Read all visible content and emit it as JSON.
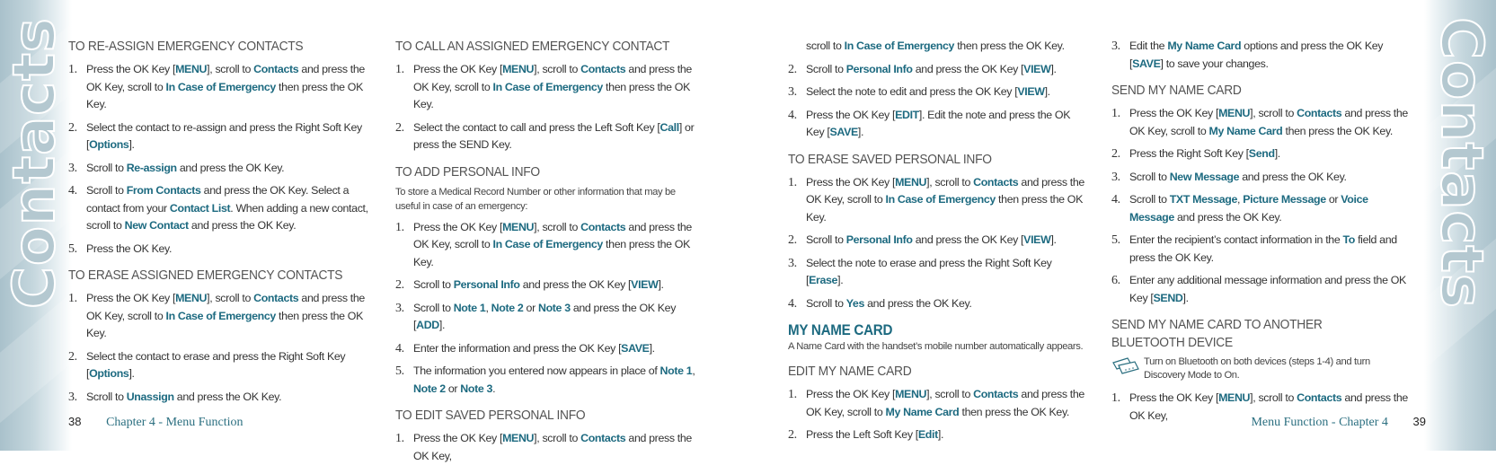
{
  "side_tab_word": "Contacts",
  "colors": {
    "accent": "#1d6a80",
    "heading": "#545454",
    "body": "#333333",
    "tab": "#b4c8d0"
  },
  "left_page": {
    "page_number": "38",
    "chapter_label": "Chapter 4 - Menu Function",
    "sections": {
      "reassign": {
        "heading": "TO RE-ASSIGN EMERGENCY CONTACTS",
        "steps": [
          [
            {
              "t": "Press the OK Key ["
            },
            {
              "h": "MENU"
            },
            {
              "t": "], scroll to "
            },
            {
              "h": "Contacts"
            },
            {
              "t": " and press the OK Key, scroll to "
            },
            {
              "h": "In Case of Emergency"
            },
            {
              "t": " then press the OK Key."
            }
          ],
          [
            {
              "t": "Select the contact to re-assign and press the Right Soft Key ["
            },
            {
              "h": "Options"
            },
            {
              "t": "]."
            }
          ],
          [
            {
              "t": "Scroll to "
            },
            {
              "h": "Re-assign"
            },
            {
              "t": " and press the OK Key."
            }
          ],
          [
            {
              "t": "Scroll to "
            },
            {
              "h": "From Contacts"
            },
            {
              "t": " and press the OK Key. Select a contact from your "
            },
            {
              "h": "Contact List"
            },
            {
              "t": ". When adding a new contact, scroll to "
            },
            {
              "h": "New Contact"
            },
            {
              "t": " and press the OK Key."
            }
          ],
          [
            {
              "t": "Press the OK Key."
            }
          ]
        ]
      },
      "erase_assigned": {
        "heading": "TO ERASE ASSIGNED EMERGENCY CONTACTS",
        "steps": [
          [
            {
              "t": "Press the OK Key ["
            },
            {
              "h": "MENU"
            },
            {
              "t": "], scroll to "
            },
            {
              "h": "Contacts"
            },
            {
              "t": " and press the OK Key, scroll to "
            },
            {
              "h": "In Case of Emergency"
            },
            {
              "t": " then press the OK Key."
            }
          ],
          [
            {
              "t": "Select the contact to erase and press the Right Soft Key ["
            },
            {
              "h": "Options"
            },
            {
              "t": "]."
            }
          ],
          [
            {
              "t": "Scroll to "
            },
            {
              "h": "Unassign"
            },
            {
              "t": " and press the OK Key."
            }
          ]
        ]
      },
      "call_assigned": {
        "heading": "TO CALL AN ASSIGNED EMERGENCY CONTACT",
        "steps": [
          [
            {
              "t": "Press the OK Key ["
            },
            {
              "h": "MENU"
            },
            {
              "t": "], scroll to "
            },
            {
              "h": "Contacts"
            },
            {
              "t": " and press the OK Key, scroll to "
            },
            {
              "h": "In Case of Emergency"
            },
            {
              "t": " then press the OK Key."
            }
          ],
          [
            {
              "t": "Select the contact to call and press the Left Soft Key ["
            },
            {
              "h": "Call"
            },
            {
              "t": "] or press the SEND Key."
            }
          ]
        ]
      },
      "add_personal": {
        "heading": "TO ADD PERSONAL INFO",
        "intro": "To store a Medical Record Number or other information that may be useful in case of an emergency:",
        "steps": [
          [
            {
              "t": "Press the OK Key ["
            },
            {
              "h": "MENU"
            },
            {
              "t": "], scroll to "
            },
            {
              "h": "Contacts"
            },
            {
              "t": " and press the OK Key, scroll to "
            },
            {
              "h": "In Case of Emergency"
            },
            {
              "t": " then press the OK Key."
            }
          ],
          [
            {
              "t": "Scroll to "
            },
            {
              "h": "Personal Info"
            },
            {
              "t": " and press the OK Key ["
            },
            {
              "h": "VIEW"
            },
            {
              "t": "]."
            }
          ],
          [
            {
              "t": "Scroll to "
            },
            {
              "h": "Note 1"
            },
            {
              "t": ", "
            },
            {
              "h": "Note 2"
            },
            {
              "t": " or "
            },
            {
              "h": "Note 3"
            },
            {
              "t": " and press the OK Key ["
            },
            {
              "h": "ADD"
            },
            {
              "t": "]."
            }
          ],
          [
            {
              "t": "Enter the information and press the OK Key ["
            },
            {
              "h": "SAVE"
            },
            {
              "t": "]."
            }
          ],
          [
            {
              "t": "The information you entered now appears in place of "
            },
            {
              "h": "Note 1"
            },
            {
              "t": ", "
            },
            {
              "h": "Note 2"
            },
            {
              "t": " or "
            },
            {
              "h": "Note 3"
            },
            {
              "t": "."
            }
          ]
        ]
      },
      "edit_personal": {
        "heading": "TO EDIT SAVED PERSONAL INFO",
        "steps": [
          [
            {
              "t": "Press the OK Key ["
            },
            {
              "h": "MENU"
            },
            {
              "t": "], scroll to "
            },
            {
              "h": "Contacts"
            },
            {
              "t": " and press the OK Key,"
            }
          ]
        ]
      }
    }
  },
  "right_page": {
    "page_number": "39",
    "chapter_label": "Menu Function - Chapter 4",
    "sections": {
      "edit_personal_cont": {
        "continued_line": [
          {
            "t": "scroll to "
          },
          {
            "h": "In Case of Emergency"
          },
          {
            "t": " then press the OK Key."
          }
        ],
        "steps": [
          [
            {
              "t": "Scroll to "
            },
            {
              "h": "Personal Info"
            },
            {
              "t": " and press the OK Key ["
            },
            {
              "h": "VIEW"
            },
            {
              "t": "]."
            }
          ],
          [
            {
              "t": "Select the note to edit and press the OK Key ["
            },
            {
              "h": "VIEW"
            },
            {
              "t": "]."
            }
          ],
          [
            {
              "t": "Press the OK Key ["
            },
            {
              "h": "EDIT"
            },
            {
              "t": "]. Edit the note and press the OK Key ["
            },
            {
              "h": "SAVE"
            },
            {
              "t": "]."
            }
          ]
        ],
        "start_number": 2
      },
      "erase_personal": {
        "heading": "TO ERASE SAVED PERSONAL INFO",
        "steps": [
          [
            {
              "t": "Press the OK Key ["
            },
            {
              "h": "MENU"
            },
            {
              "t": "], scroll to "
            },
            {
              "h": "Contacts"
            },
            {
              "t": " and press the OK Key, scroll to "
            },
            {
              "h": "In Case of Emergency"
            },
            {
              "t": " then press the OK Key."
            }
          ],
          [
            {
              "t": "Scroll to "
            },
            {
              "h": "Personal Info"
            },
            {
              "t": " and press the OK Key ["
            },
            {
              "h": "VIEW"
            },
            {
              "t": "]."
            }
          ],
          [
            {
              "t": "Select the note to erase and press the Right Soft Key ["
            },
            {
              "h": "Erase"
            },
            {
              "t": "]."
            }
          ],
          [
            {
              "t": "Scroll to "
            },
            {
              "h": "Yes"
            },
            {
              "t": " and press the OK Key."
            }
          ]
        ]
      },
      "my_name_card": {
        "heading": "MY NAME CARD",
        "intro": "A Name Card with the handset’s mobile number automatically appears."
      },
      "edit_name_card": {
        "heading": "EDIT MY NAME CARD",
        "steps": [
          [
            {
              "t": "Press the OK Key ["
            },
            {
              "h": "MENU"
            },
            {
              "t": "], scroll to "
            },
            {
              "h": "Contacts"
            },
            {
              "t": " and press the OK Key, scroll to "
            },
            {
              "h": "My Name Card"
            },
            {
              "t": " then press the OK Key."
            }
          ],
          [
            {
              "t": "Press the Left Soft Key ["
            },
            {
              "h": "Edit"
            },
            {
              "t": "]."
            }
          ],
          [
            {
              "t": "Edit the "
            },
            {
              "h": "My Name Card"
            },
            {
              "t": " options and press the OK Key ["
            },
            {
              "h": "SAVE"
            },
            {
              "t": "] to save your changes."
            }
          ]
        ]
      },
      "send_name_card": {
        "heading": "SEND MY NAME CARD",
        "steps": [
          [
            {
              "t": "Press the OK Key ["
            },
            {
              "h": "MENU"
            },
            {
              "t": "], scroll to "
            },
            {
              "h": "Contacts"
            },
            {
              "t": " and press the OK Key, scroll to "
            },
            {
              "h": "My Name Card"
            },
            {
              "t": " then press the OK Key."
            }
          ],
          [
            {
              "t": "Press the Right Soft Key ["
            },
            {
              "h": "Send"
            },
            {
              "t": "]."
            }
          ],
          [
            {
              "t": "Scroll to "
            },
            {
              "h": "New Message"
            },
            {
              "t": " and press the OK Key."
            }
          ],
          [
            {
              "t": "Scroll to "
            },
            {
              "h": "TXT Message"
            },
            {
              "t": ", "
            },
            {
              "h": "Picture Message"
            },
            {
              "t": " or "
            },
            {
              "h": "Voice Message"
            },
            {
              "t": " and press the OK Key."
            }
          ],
          [
            {
              "t": "Enter the recipient’s contact information in the "
            },
            {
              "h": "To"
            },
            {
              "t": " field and press the OK Key."
            }
          ],
          [
            {
              "t": "Enter any additional message information and press the OK Key ["
            },
            {
              "h": "SEND"
            },
            {
              "t": "]."
            }
          ]
        ]
      },
      "send_bluetooth": {
        "heading": "SEND MY NAME CARD TO ANOTHER BLUETOOTH DEVICE",
        "note": "Turn on Bluetooth on both devices (steps 1-4) and turn Discovery Mode to On.",
        "note_icon": "note-cards-icon",
        "steps": [
          [
            {
              "t": "Press the OK Key ["
            },
            {
              "h": "MENU"
            },
            {
              "t": "], scroll to "
            },
            {
              "h": "Contacts"
            },
            {
              "t": " and press the OK Key,"
            }
          ]
        ]
      }
    }
  }
}
